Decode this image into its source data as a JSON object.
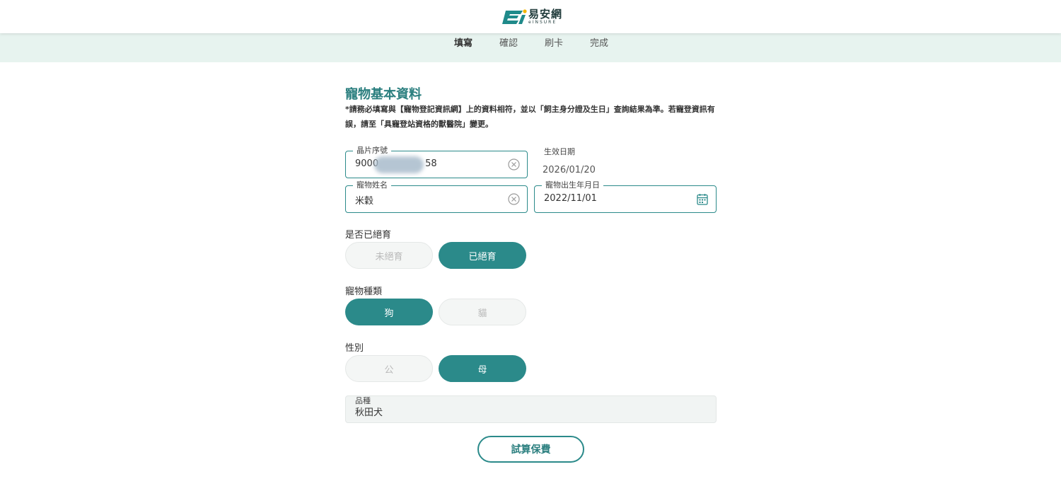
{
  "header": {
    "logo_cn": "易安網",
    "logo_en": "eINSURE",
    "logo_colors": {
      "teal": "#1f8a8a",
      "dark": "#1f3a3a",
      "accent": "#f2b600"
    }
  },
  "steps": [
    {
      "label": "填寫",
      "active": true
    },
    {
      "label": "確認",
      "active": false
    },
    {
      "label": "刷卡",
      "active": false
    },
    {
      "label": "完成",
      "active": false
    }
  ],
  "section": {
    "title": "寵物基本資料",
    "notice": "*請務必填寫與【寵物登記資訊網】上的資料相符，並以「飼主身分證及生日」查詢結果為準。若寵登資訊有誤，請至「具寵登站資格的獸醫院」變更。"
  },
  "fields": {
    "chip": {
      "label": "晶片序號",
      "value_prefix": "9000",
      "value_suffix": "58",
      "icon": "clear-icon"
    },
    "effective_date": {
      "label": "生效日期",
      "value": "2026/01/20"
    },
    "pet_name": {
      "label": "寵物姓名",
      "value": "米穀",
      "icon": "clear-icon"
    },
    "birthday": {
      "label": "寵物出生年月日",
      "value": "2022/11/01",
      "icon": "calendar-icon"
    }
  },
  "neutered": {
    "label": "是否已絕育",
    "options": [
      "未絕育",
      "已絕育"
    ],
    "selected": "已絕育"
  },
  "species": {
    "label": "寵物種類",
    "options": [
      "狗",
      "貓"
    ],
    "selected": "狗"
  },
  "gender": {
    "label": "性別",
    "options": [
      "公",
      "母"
    ],
    "selected": "母"
  },
  "breed": {
    "label": "品種",
    "value": "秋田犬"
  },
  "actions": {
    "calculate_label": "試算保費"
  },
  "colors": {
    "primary": "#2b8a8a",
    "step_bar_bg": "#e7f3ef",
    "title": "#2b7f7f"
  }
}
